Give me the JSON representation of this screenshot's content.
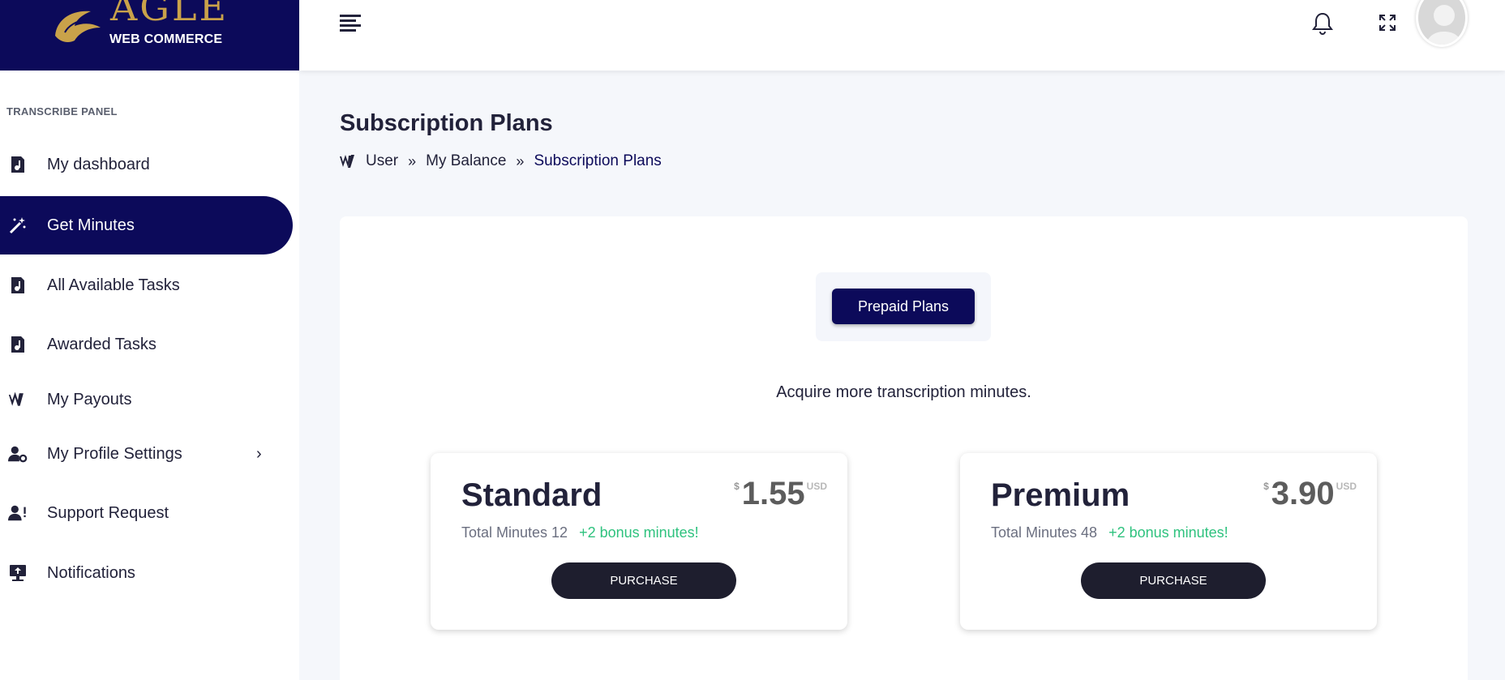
{
  "brand": {
    "name_big": "AGLE",
    "name_small": "WEB COMMERCE"
  },
  "sidebar": {
    "panel_label": "TRANSCRIBE PANEL",
    "items": [
      {
        "label": "My dashboard",
        "icon": "music-file-icon",
        "active": false
      },
      {
        "label": "Get Minutes",
        "icon": "magic-wand-icon",
        "active": true
      },
      {
        "label": "All Available Tasks",
        "icon": "music-file-icon",
        "active": false
      },
      {
        "label": "Awarded Tasks",
        "icon": "music-file-icon",
        "active": false
      },
      {
        "label": "My Payouts",
        "icon": "payout-logo-icon",
        "active": false
      },
      {
        "label": "My Profile Settings",
        "icon": "user-gear-icon",
        "active": false,
        "has_submenu": true
      },
      {
        "label": "Support Request",
        "icon": "user-alert-icon",
        "active": false
      },
      {
        "label": "Notifications",
        "icon": "upload-screen-icon",
        "active": false
      }
    ]
  },
  "topbar": {
    "icons": [
      "menu-icon",
      "bell-icon",
      "fullscreen-icon",
      "avatar"
    ]
  },
  "header": {
    "title": "Subscription Plans",
    "breadcrumb": [
      "User",
      "My Balance",
      "Subscription Plans"
    ]
  },
  "content": {
    "toggle_label": "Prepaid Plans",
    "intro": "Acquire more transcription minutes.",
    "plans": [
      {
        "name": "Standard",
        "currency_symbol": "$",
        "price": "1.55",
        "currency": "USD",
        "minutes_text": "Total Minutes 12",
        "bonus_text": "+2 bonus minutes!",
        "button_label": "PURCHASE"
      },
      {
        "name": "Premium",
        "currency_symbol": "$",
        "price": "3.90",
        "currency": "USD",
        "minutes_text": "Total Minutes 48",
        "bonus_text": "+2 bonus minutes!",
        "button_label": "PURCHASE"
      }
    ]
  },
  "colors": {
    "brand_navy": "#0c0a5a",
    "gold": "#c9a24a",
    "bonus_green": "#2ec27e",
    "button_dark": "#1e1e2e"
  }
}
